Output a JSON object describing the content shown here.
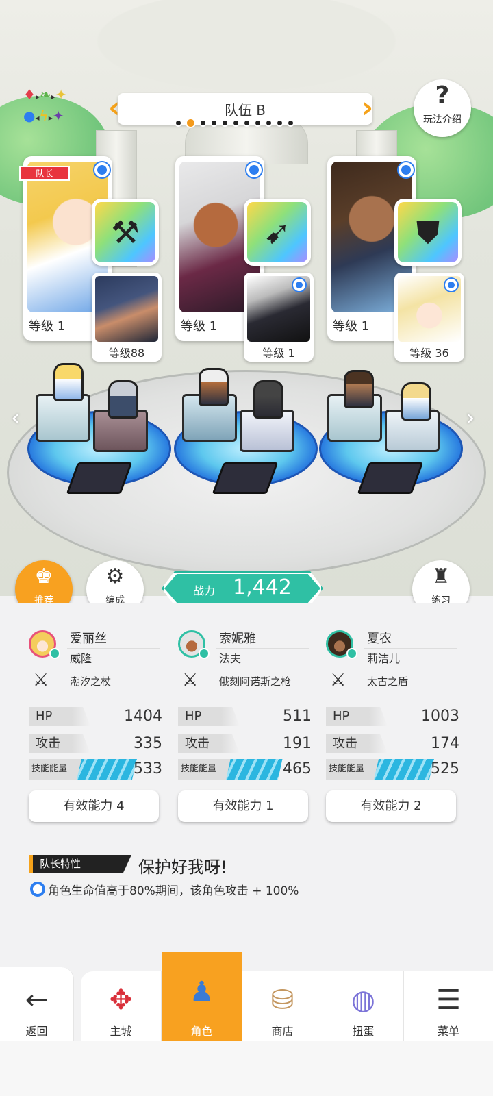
{
  "header": {
    "team_title": "队伍 B",
    "page_dots_total": 11,
    "page_dots_active_index": 1,
    "help_label": "玩法介绍"
  },
  "party": [
    {
      "leader_tag": "队长",
      "level_label": "等级 1",
      "support_level_label": "等级88",
      "name": "爱丽丝",
      "support_name": "威隆",
      "weapon": "潮汐之杖",
      "hp": "1404",
      "atk": "335",
      "skill_energy": "533",
      "energy_fill": 0.8,
      "ability_label": "有效能力 4"
    },
    {
      "level_label": "等级 1",
      "support_level_label": "等级 1",
      "name": "索妮雅",
      "support_name": "法夫",
      "weapon": "俄刻阿诺斯之枪",
      "hp": "511",
      "atk": "191",
      "skill_energy": "465",
      "energy_fill": 0.75,
      "ability_label": "有效能力 1"
    },
    {
      "level_label": "等级 1",
      "support_level_label": "等级 36",
      "name": "夏农",
      "support_name": "莉洁儿",
      "weapon": "太古之盾",
      "hp": "1003",
      "atk": "174",
      "skill_energy": "525",
      "energy_fill": 0.8,
      "ability_label": "有效能力 2"
    }
  ],
  "stat_labels": {
    "hp": "HP",
    "atk": "攻击",
    "energy": "技能能量"
  },
  "buttons": {
    "recommend": "推荐",
    "formation": "编成",
    "practice": "练习"
  },
  "power": {
    "label": "战力",
    "value": "1,442"
  },
  "leader_trait": {
    "tag": "队长特性",
    "title": "保护好我呀!",
    "desc": "角色生命值高于80%期间，该角色攻击 + 100%"
  },
  "nav": {
    "back": "返回",
    "main_city": "主城",
    "character": "角色",
    "shop": "商店",
    "gacha": "扭蛋",
    "menu": "菜单"
  },
  "colors": {
    "accent": "#f8a120",
    "power": "#2fc0a4",
    "leader_tag": "#e8343e",
    "energy": "#2bb6e0"
  }
}
